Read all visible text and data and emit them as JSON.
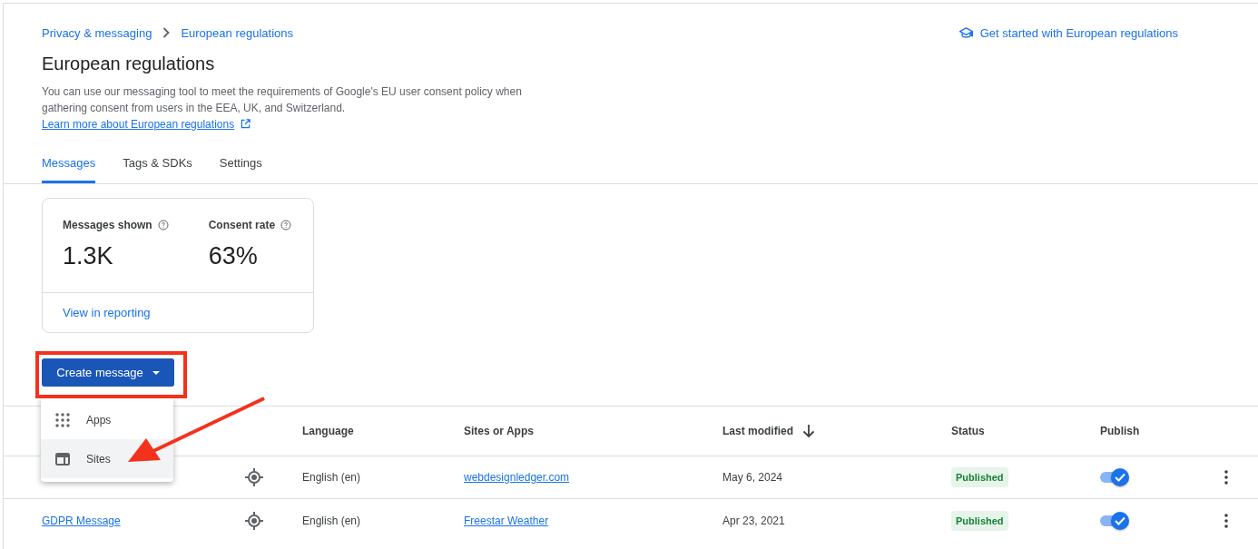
{
  "breadcrumb": [
    {
      "label": "Privacy & messaging"
    },
    {
      "label": "European regulations"
    }
  ],
  "help_link": {
    "label": "Get started with European regulations"
  },
  "title": "European regulations",
  "description": {
    "text": "You can use our messaging tool to meet the requirements of Google's EU user consent policy when gathering consent from users in the EEA, UK, and Switzerland.",
    "link": "Learn more about European regulations"
  },
  "tabs": [
    {
      "label": "Messages",
      "selected": true
    },
    {
      "label": "Tags & SDKs",
      "selected": false
    },
    {
      "label": "Settings",
      "selected": false
    }
  ],
  "stats": {
    "metrics": [
      {
        "label": "Messages shown",
        "value": "1.3K"
      },
      {
        "label": "Consent rate",
        "value": "63%"
      }
    ],
    "link": "View in reporting"
  },
  "create_button": {
    "label": "Create message"
  },
  "create_menu": [
    {
      "label": "Apps",
      "kind": "apps",
      "highlighted": false
    },
    {
      "label": "Sites",
      "kind": "sites",
      "highlighted": true
    }
  ],
  "table": {
    "columns": [
      "Language",
      "Sites or Apps",
      "Last modified",
      "Status",
      "Publish"
    ],
    "rows": [
      {
        "language": "English (en)",
        "site": "webdesignledger.com",
        "modified": "May 6, 2024",
        "status": "Published",
        "published": true
      },
      {
        "name": "GDPR Message",
        "language": "English (en)",
        "site": "Freestar Weather",
        "modified": "Apr 23, 2021",
        "status": "Published",
        "published": true
      }
    ]
  }
}
